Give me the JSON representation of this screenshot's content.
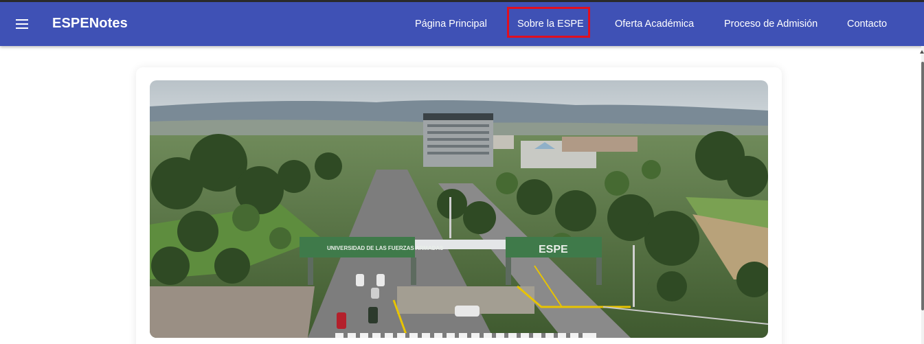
{
  "app": {
    "title": "ESPENotes"
  },
  "nav": {
    "items": [
      {
        "label": "Página Principal"
      },
      {
        "label": "Sobre la ESPE"
      },
      {
        "label": "Oferta Académica"
      },
      {
        "label": "Proceso de Admisión"
      },
      {
        "label": "Contacto"
      }
    ],
    "highlighted_index": 1
  },
  "hero": {
    "gate_text_left": "UNIVERSIDAD DE LAS FUERZAS ARMADAS",
    "gate_text_right": "ESPE"
  },
  "colors": {
    "appbar": "#3f51b5",
    "highlight": "#e10f1f"
  },
  "icons": {
    "menu": "menu-icon"
  }
}
